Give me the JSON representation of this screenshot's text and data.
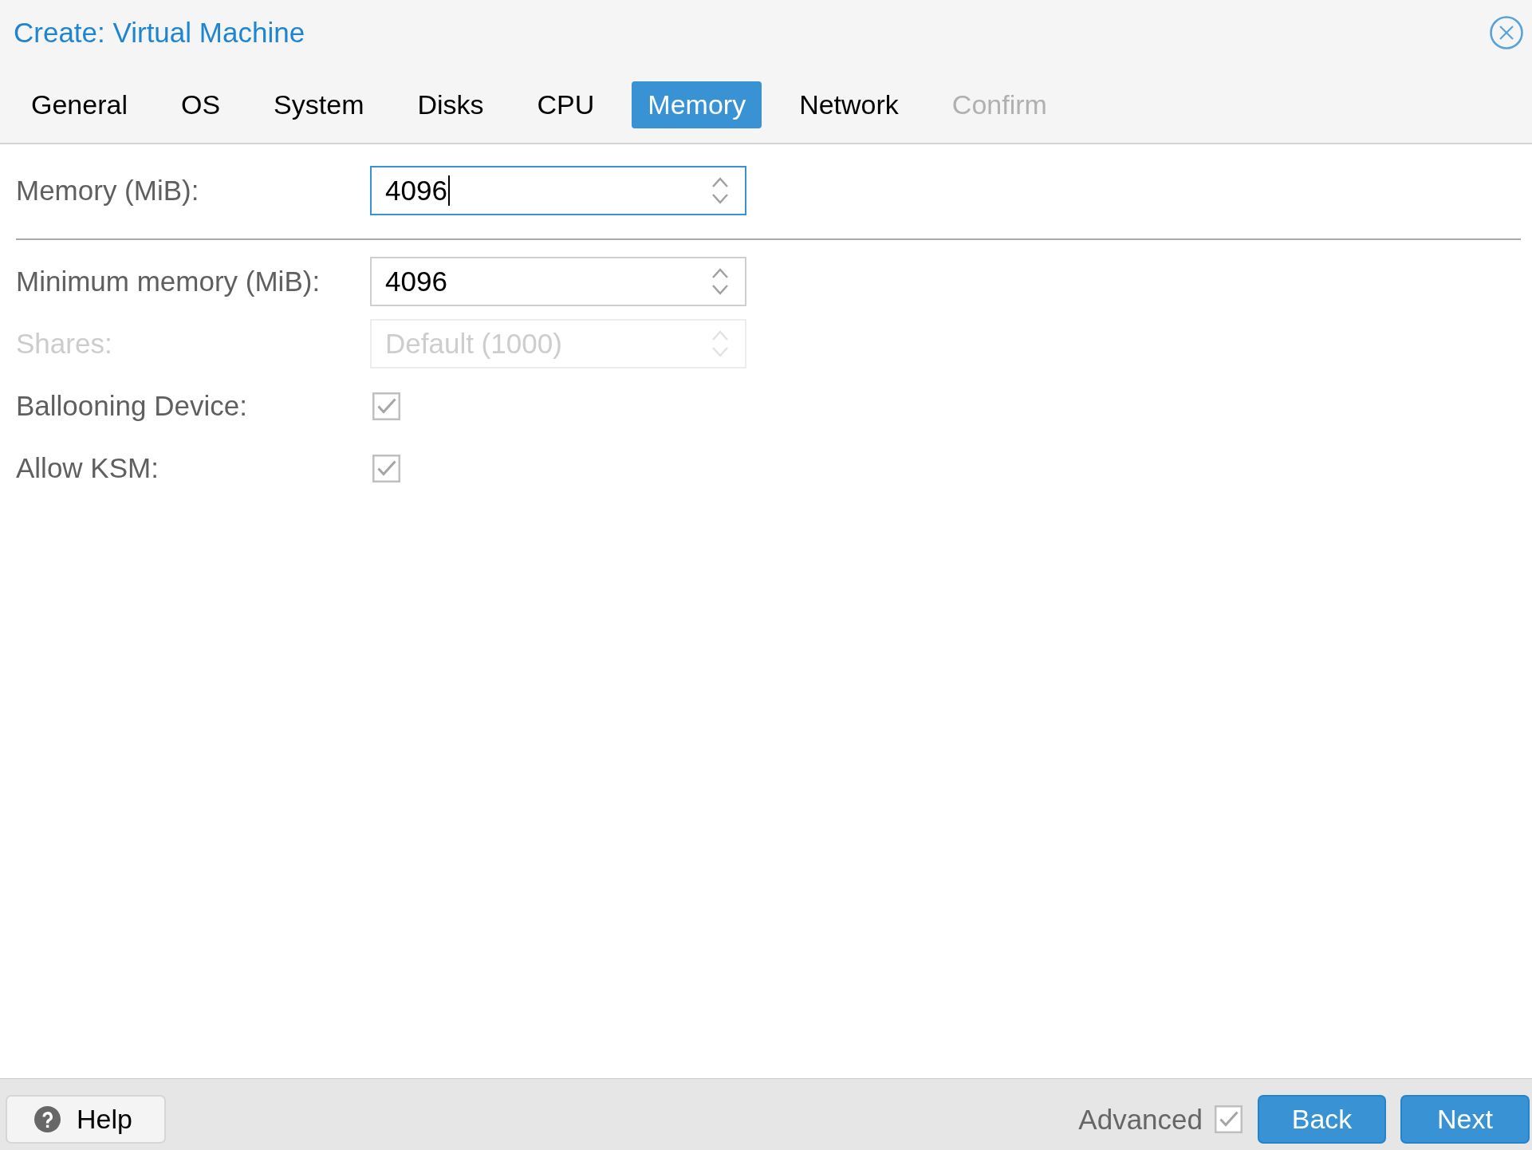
{
  "window": {
    "title": "Create: Virtual Machine"
  },
  "tabs": [
    {
      "label": "General",
      "selected": false,
      "disabled": false
    },
    {
      "label": "OS",
      "selected": false,
      "disabled": false
    },
    {
      "label": "System",
      "selected": false,
      "disabled": false
    },
    {
      "label": "Disks",
      "selected": false,
      "disabled": false
    },
    {
      "label": "CPU",
      "selected": false,
      "disabled": false
    },
    {
      "label": "Memory",
      "selected": true,
      "disabled": false
    },
    {
      "label": "Network",
      "selected": false,
      "disabled": false
    },
    {
      "label": "Confirm",
      "selected": false,
      "disabled": true
    }
  ],
  "form": {
    "sections": [
      {
        "fields": [
          {
            "kind": "number",
            "label": "Memory (MiB):",
            "value": "4096",
            "focused": true,
            "disabled": false
          }
        ]
      },
      {
        "fields": [
          {
            "kind": "number",
            "label": "Minimum memory (MiB):",
            "value": "4096",
            "focused": false,
            "disabled": false
          },
          {
            "kind": "number",
            "label": "Shares:",
            "placeholder": "Default (1000)",
            "focused": false,
            "disabled": true
          },
          {
            "kind": "checkbox",
            "label": "Ballooning Device:",
            "checked": true,
            "focused": false,
            "disabled": false
          },
          {
            "kind": "checkbox",
            "label": "Allow KSM:",
            "checked": true,
            "focused": false,
            "disabled": false
          }
        ]
      }
    ]
  },
  "footer": {
    "help_button": "Help",
    "advanced": {
      "label": "Advanced",
      "checked": true
    },
    "buttons": [
      "Back",
      "Next"
    ]
  }
}
